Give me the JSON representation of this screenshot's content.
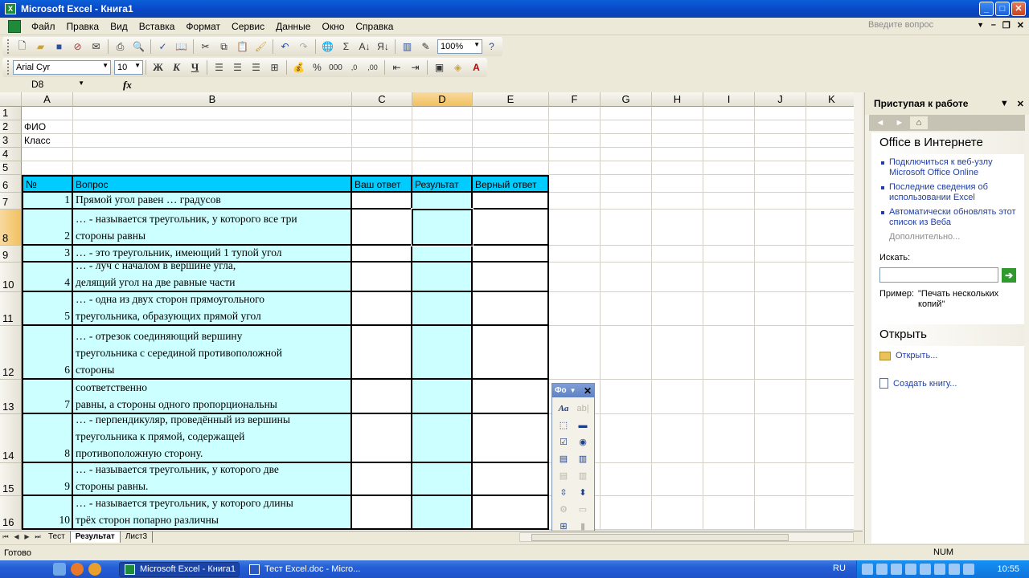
{
  "window": {
    "title": "Microsoft Excel - Книга1",
    "menu": [
      "Файл",
      "Правка",
      "Вид",
      "Вставка",
      "Формат",
      "Сервис",
      "Данные",
      "Окно",
      "Справка"
    ],
    "help_placeholder": "Введите вопрос"
  },
  "toolbar": {
    "zoom": "100%",
    "font_name": "Arial Cyr",
    "font_size": "10",
    "bold": "Ж",
    "italic": "К",
    "underline": "Ч",
    "percent": "%",
    "thousands": "000"
  },
  "formula_bar": {
    "cell_ref": "D8",
    "fx": "fx",
    "content": ""
  },
  "sheet": {
    "columns": [
      "A",
      "B",
      "C",
      "D",
      "E",
      "F",
      "G",
      "H",
      "I",
      "J",
      "K"
    ],
    "selected_column": "D",
    "selected_row": "8",
    "row_numbers": [
      "1",
      "2",
      "3",
      "4",
      "5",
      "6",
      "7",
      "8",
      "9",
      "10",
      "11",
      "12",
      "13",
      "14",
      "15",
      "16"
    ],
    "labels": {
      "fio": "ФИО",
      "class": "Класс"
    },
    "header": {
      "no": "№",
      "question": "Вопрос",
      "your_answer": "Ваш ответ",
      "result": "Результат",
      "correct_answer": "Верный ответ"
    },
    "header_color": "#00CCFF",
    "question_fill": "#CCFFFF",
    "questions": [
      {
        "n": "1",
        "text": "Прямой угол равен … градусов"
      },
      {
        "n": "2",
        "text": "… - называется треугольник, у которого все три\nстороны равны"
      },
      {
        "n": "3",
        "text": "… - это треугольник, имеющий 1 тупой угол"
      },
      {
        "n": "4",
        "text": "… - луч с началом в вершине угла,\nделящий угол на две равные части"
      },
      {
        "n": "5",
        "text": "… - одна из двух сторон прямоугольного\nтреугольника, образующих прямой угол"
      },
      {
        "n": "6",
        "text": "… - отрезок соединяющий вершину\nтреугольника с серединой противоположной\nстороны"
      },
      {
        "n": "7",
        "text": "соответственно\nравны, а стороны одного пропорциональны"
      },
      {
        "n": "8",
        "text": "… - перпендикуляр, проведённый из вершины\nтреугольника к прямой, содержащей\nпротивоположную сторону."
      },
      {
        "n": "9",
        "text": "… - называется треугольник, у которого две\nстороны равны."
      },
      {
        "n": "10",
        "text": "… - называется треугольник, у которого длины\nтрёх сторон попарно различны"
      }
    ]
  },
  "sheet_tabs": [
    "Тест",
    "Результат",
    "Лист3"
  ],
  "active_tab": "Результат",
  "forms_toolbar": {
    "title": "Фо"
  },
  "task_pane": {
    "title": "Приступая к работе",
    "section_online": "Office в Интернете",
    "links": [
      "Подключиться к веб-узлу Microsoft Office Online",
      "Последние сведения об использовании Excel",
      "Автоматически обновлять этот список из Веба"
    ],
    "more": "Дополнительно...",
    "search_label": "Искать:",
    "example_label": "Пример:",
    "example_value": "\"Печать нескольких копий\"",
    "section_open": "Открыть",
    "open_link": "Открыть...",
    "create_link": "Создать книгу..."
  },
  "status": {
    "ready": "Готово",
    "num": "NUM"
  },
  "taskbar": {
    "tasks": [
      "Microsoft Excel - Книга1",
      "Тест Excel.doc - Micro..."
    ],
    "lang": "RU",
    "clock": "10:55"
  }
}
